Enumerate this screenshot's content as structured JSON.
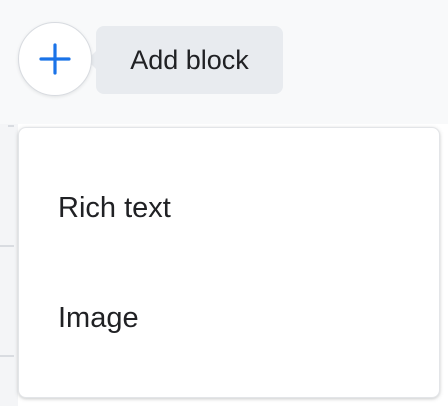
{
  "add_block": {
    "icon": "plus-icon",
    "accent_color": "#1a73e8",
    "tooltip_label": "Add block"
  },
  "menu": {
    "items": [
      {
        "label": "Rich text"
      },
      {
        "label": "Image"
      }
    ]
  }
}
